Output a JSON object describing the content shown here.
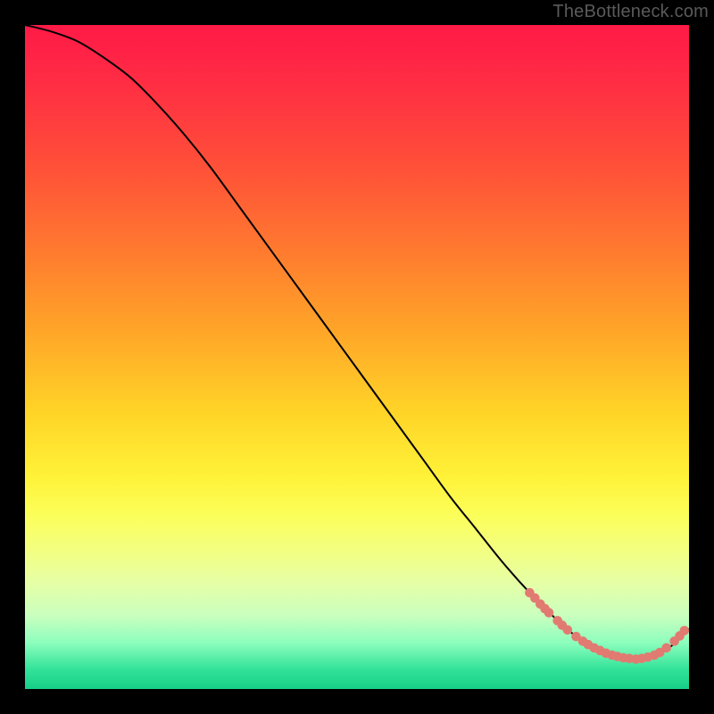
{
  "watermark": "TheBottleneck.com",
  "chart_data": {
    "type": "line",
    "title": "",
    "xlabel": "",
    "ylabel": "",
    "xlim": [
      0,
      100
    ],
    "ylim": [
      0,
      100
    ],
    "series": [
      {
        "name": "bottleneck-curve",
        "x": [
          0,
          4,
          8,
          12,
          16,
          20,
          24,
          28,
          32,
          36,
          40,
          44,
          48,
          52,
          56,
          60,
          64,
          68,
          72,
          76,
          80,
          82,
          84,
          86,
          88,
          90,
          92,
          94,
          96,
          98,
          100
        ],
        "y": [
          100,
          99,
          97.5,
          95,
          92,
          88,
          83.5,
          78.5,
          73,
          67.5,
          62,
          56.5,
          51,
          45.5,
          40,
          34.5,
          29,
          24,
          19,
          14.5,
          10.5,
          8.7,
          7.3,
          6.1,
          5.2,
          4.6,
          4.5,
          4.8,
          5.6,
          7.0,
          9.0
        ]
      }
    ],
    "markers": [
      {
        "x": 76.0,
        "y": 14.5
      },
      {
        "x": 76.8,
        "y": 13.7
      },
      {
        "x": 77.6,
        "y": 12.8
      },
      {
        "x": 78.3,
        "y": 12.1
      },
      {
        "x": 78.9,
        "y": 11.5
      },
      {
        "x": 80.2,
        "y": 10.3
      },
      {
        "x": 80.9,
        "y": 9.6
      },
      {
        "x": 81.7,
        "y": 8.9
      },
      {
        "x": 83.0,
        "y": 7.9
      },
      {
        "x": 84.0,
        "y": 7.2
      },
      {
        "x": 84.8,
        "y": 6.7
      },
      {
        "x": 85.7,
        "y": 6.2
      },
      {
        "x": 86.6,
        "y": 5.8
      },
      {
        "x": 87.5,
        "y": 5.4
      },
      {
        "x": 88.4,
        "y": 5.1
      },
      {
        "x": 89.2,
        "y": 4.9
      },
      {
        "x": 90.1,
        "y": 4.7
      },
      {
        "x": 91.0,
        "y": 4.6
      },
      {
        "x": 92.0,
        "y": 4.5
      },
      {
        "x": 92.9,
        "y": 4.6
      },
      {
        "x": 93.8,
        "y": 4.8
      },
      {
        "x": 94.8,
        "y": 5.1
      },
      {
        "x": 95.6,
        "y": 5.5
      },
      {
        "x": 96.6,
        "y": 6.2
      },
      {
        "x": 97.8,
        "y": 7.2
      },
      {
        "x": 98.6,
        "y": 8.0
      },
      {
        "x": 99.3,
        "y": 8.8
      }
    ],
    "marker_color": "#e17b72",
    "curve_color": "#000000"
  }
}
